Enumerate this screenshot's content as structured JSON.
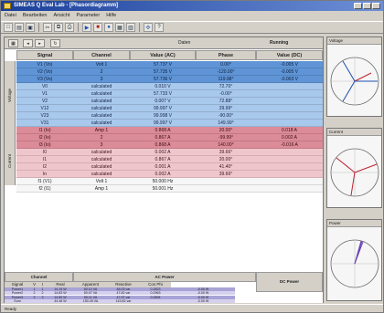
{
  "window": {
    "title": "SIMEAS Q Eval Lab - [Phasordiagramm]"
  },
  "menu": [
    "Datei",
    "Bearbeiten",
    "Ansicht",
    "Parameter",
    "Hilfe"
  ],
  "subtoolbar": {
    "label": "Daten",
    "mode_label": "Running"
  },
  "table": {
    "headers": [
      "Signal",
      "Channel",
      "Value (AC)",
      "Phase",
      "Value (DC)"
    ],
    "rows": [
      {
        "signal": "V1 (Vo)",
        "channel": "Volt 1",
        "ac": "57.737 V",
        "phase": "0.00°",
        "dc": "-0.005 V",
        "cls": "blue1"
      },
      {
        "signal": "V2 (Vo)",
        "channel": "2",
        "ac": "57.735 V",
        "phase": "-120.00°",
        "dc": "-0.005 V",
        "cls": "blue1"
      },
      {
        "signal": "V3 (Vo)",
        "channel": "3",
        "ac": "57.736 V",
        "phase": "119.98°",
        "dc": "-0.003 V",
        "cls": "blue1"
      },
      {
        "signal": "V0",
        "channel": "calculated",
        "ac": "0.010 V",
        "phase": "72.70°",
        "dc": "",
        "cls": "blue2"
      },
      {
        "signal": "V1",
        "channel": "calculated",
        "ac": "57.733 V",
        "phase": "-0.00°",
        "dc": "",
        "cls": "blue2"
      },
      {
        "signal": "V2",
        "channel": "calculated",
        "ac": "0.007 V",
        "phase": "72.88°",
        "dc": "",
        "cls": "blue2"
      },
      {
        "signal": "V12",
        "channel": "calculated",
        "ac": "99.997 V",
        "phase": "29.99°",
        "dc": "",
        "cls": "blue2"
      },
      {
        "signal": "V23",
        "channel": "calculated",
        "ac": "99.998 V",
        "phase": "-90.00°",
        "dc": "",
        "cls": "blue2"
      },
      {
        "signal": "V31",
        "channel": "calculated",
        "ac": "99.997 V",
        "phase": "149.99°",
        "dc": "",
        "cls": "blue2"
      },
      {
        "signal": "I1 (Io)",
        "channel": "Amp 1",
        "ac": "0.868 A",
        "phase": "20.00°",
        "dc": "0.018 A",
        "cls": "red1"
      },
      {
        "signal": "I2 (Io)",
        "channel": "2",
        "ac": "0.867 A",
        "phase": "-99.99°",
        "dc": "0.002 A",
        "cls": "red1"
      },
      {
        "signal": "I3 (Io)",
        "channel": "3",
        "ac": "0.868 A",
        "phase": "140.00°",
        "dc": "-0.016 A",
        "cls": "red1"
      },
      {
        "signal": "I0",
        "channel": "calculated",
        "ac": "0.002 A",
        "phase": "39.66°",
        "dc": "",
        "cls": "red2"
      },
      {
        "signal": "I1",
        "channel": "calculated",
        "ac": "0.867 A",
        "phase": "20.00°",
        "dc": "",
        "cls": "red2"
      },
      {
        "signal": "I2",
        "channel": "calculated",
        "ac": "0.001 A",
        "phase": "41.40°",
        "dc": "",
        "cls": "red2"
      },
      {
        "signal": "In",
        "channel": "calculated",
        "ac": "0.002 A",
        "phase": "39.66°",
        "dc": "",
        "cls": "red2"
      },
      {
        "signal": "f1 (V1)",
        "channel": "Volt 1",
        "ac": "50.000 Hz",
        "phase": "",
        "dc": "",
        "cls": "white"
      },
      {
        "signal": "f2 (I1)",
        "channel": "Amp 1",
        "ac": "50.001 Hz",
        "phase": "",
        "dc": "",
        "cls": "white"
      }
    ],
    "side_labels": [
      "Voltage",
      "Current"
    ]
  },
  "power": {
    "group_headers": [
      "Channel",
      "AC Power",
      "DC Power"
    ],
    "headers": [
      "Signal",
      "V",
      "I",
      "Real",
      "Apparent",
      "Reactive",
      "Cos Phi",
      "DC Power"
    ],
    "rows": [
      {
        "signal": "Power1",
        "v": "1",
        "i": "1",
        "real": "14.15 W",
        "apparent": "50.10 VA",
        "reactive": "48.03 var",
        "cos": "0.2823",
        "dc": "-0.00 W",
        "cls": "purple"
      },
      {
        "signal": "Power2",
        "v": "2",
        "i": "2",
        "real": "14.83 W",
        "apparent": "50.07 VA",
        "reactive": "47.82 var",
        "cos": "0.2963",
        "dc": "-0.00 W",
        "cls": "lav"
      },
      {
        "signal": "Power3",
        "v": "3",
        "i": "3",
        "real": "14.50 W",
        "apparent": "50.11 VA",
        "reactive": "47.97 var",
        "cos": "0.2894",
        "dc": "-0.00 W",
        "cls": "purple"
      },
      {
        "signal": "Sum",
        "v": "",
        "i": "",
        "real": "44.48 W",
        "apparent": "150.28 VA",
        "reactive": "143.82 var",
        "cos": "",
        "dc": "-0.00 W",
        "cls": "lav"
      }
    ]
  },
  "phasors": {
    "panel1_title": "Voltage",
    "panel2_title": "Current",
    "panel3_title": "Power"
  },
  "status": {
    "text": "Ready"
  }
}
